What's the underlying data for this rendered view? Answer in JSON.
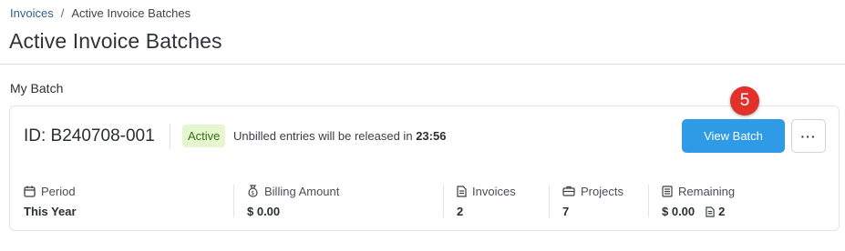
{
  "breadcrumb": {
    "parent": "Invoices",
    "separator": "/",
    "current": "Active Invoice Batches"
  },
  "page": {
    "title": "Active Invoice Batches",
    "section_label": "My Batch"
  },
  "batch": {
    "id_text": "ID: B240708-001",
    "status": "Active",
    "release_prefix": "Unbilled entries will be released in",
    "release_time": "23:56",
    "view_button": "View Batch",
    "more_button": "···",
    "step_badge": "5",
    "stats": {
      "period": {
        "label": "Period",
        "value": "This Year",
        "icon": "calendar-icon"
      },
      "billing": {
        "label": "Billing Amount",
        "value": "$ 0.00",
        "icon": "money-bag-icon"
      },
      "invoices": {
        "label": "Invoices",
        "value": "2",
        "icon": "document-icon"
      },
      "projects": {
        "label": "Projects",
        "value": "7",
        "icon": "briefcase-icon"
      },
      "remaining": {
        "label": "Remaining",
        "amount": "$ 0.00",
        "count": "2",
        "icon": "ledger-icon"
      }
    }
  },
  "colors": {
    "accent": "#2f9be6",
    "badge_bg": "#e6f6cf",
    "step_badge": "#e2312b"
  }
}
